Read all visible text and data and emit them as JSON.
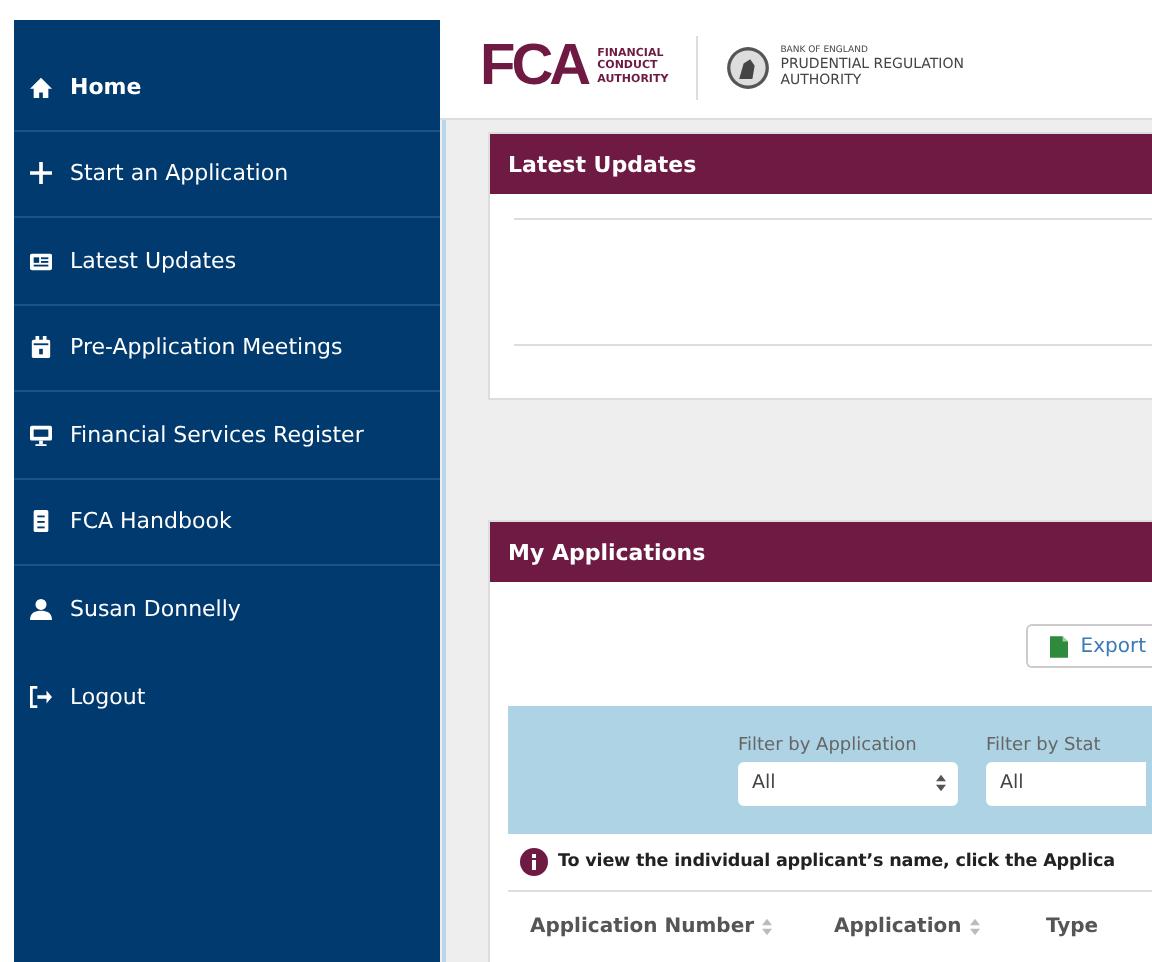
{
  "sidebar": {
    "nav_items": [
      {
        "label": "Home",
        "selected": true
      },
      {
        "label": "Start an Application",
        "selected": false
      },
      {
        "label": "Latest Updates",
        "selected": false
      },
      {
        "label": "Pre-Application Meetings",
        "selected": false
      },
      {
        "label": "Financial Services Register",
        "selected": false
      },
      {
        "label": "FCA Handbook",
        "selected": false
      }
    ],
    "account_items": [
      {
        "label": "Susan Donnelly"
      },
      {
        "label": "Logout"
      }
    ]
  },
  "header": {
    "fca_logo": {
      "mark": "FCA",
      "lines": [
        "FINANCIAL",
        "CONDUCT",
        "AUTHORITY"
      ]
    },
    "pra_logo": {
      "lines": [
        "BANK OF ENGLAND",
        "PRUDENTIAL REGULATION",
        "AUTHORITY"
      ]
    }
  },
  "latest_updates": {
    "title": "Latest Updates"
  },
  "my_applications": {
    "title": "My Applications",
    "export_button": "Export",
    "filters": [
      {
        "label": "Filter by Application",
        "value": "All"
      },
      {
        "label": "Filter by Stat",
        "value": "All"
      }
    ],
    "info": "To view the individual applicant’s name, click the Applica",
    "columns": [
      "Application Number",
      "Application",
      "Type"
    ]
  }
}
